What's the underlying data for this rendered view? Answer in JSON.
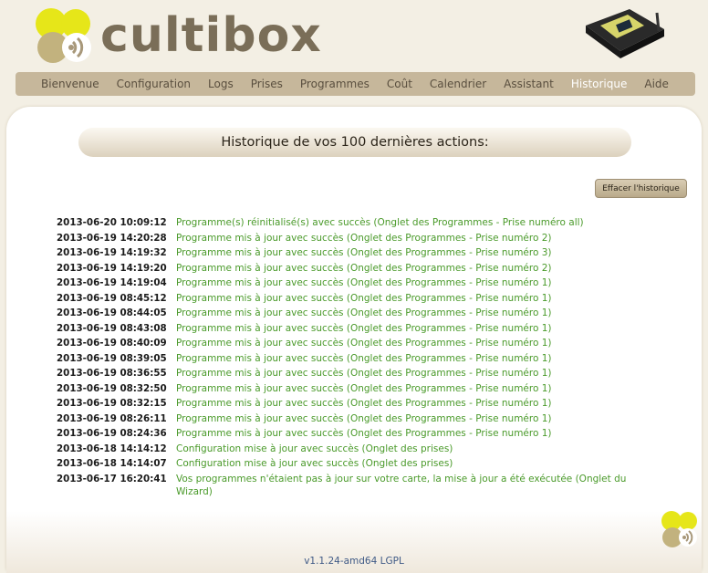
{
  "brand": {
    "logo_text": "cultibox"
  },
  "nav": {
    "items": [
      {
        "label": "Bienvenue"
      },
      {
        "label": "Configuration"
      },
      {
        "label": "Logs"
      },
      {
        "label": "Prises"
      },
      {
        "label": "Programmes"
      },
      {
        "label": "Coût"
      },
      {
        "label": "Calendrier"
      },
      {
        "label": "Assistant"
      },
      {
        "label": "Historique",
        "active": true
      },
      {
        "label": "Aide"
      }
    ]
  },
  "main": {
    "title": "Historique de vos 100 dernières actions:",
    "clear_button": "Effacer l'historique",
    "log": [
      {
        "date": "2013-06-20 10:09:12",
        "message": "Programme(s) réinitialisé(s) avec succès (Onglet des Programmes - Prise numéro all)"
      },
      {
        "date": "2013-06-19 14:20:28",
        "message": "Programme mis à jour avec succès (Onglet des Programmes - Prise numéro 2)"
      },
      {
        "date": "2013-06-19 14:19:32",
        "message": "Programme mis à jour avec succès (Onglet des Programmes - Prise numéro 3)"
      },
      {
        "date": "2013-06-19 14:19:20",
        "message": "Programme mis à jour avec succès (Onglet des Programmes - Prise numéro 2)"
      },
      {
        "date": "2013-06-19 14:19:04",
        "message": "Programme mis à jour avec succès (Onglet des Programmes - Prise numéro 1)"
      },
      {
        "date": "2013-06-19 08:45:12",
        "message": "Programme mis à jour avec succès (Onglet des Programmes - Prise numéro 1)"
      },
      {
        "date": "2013-06-19 08:44:05",
        "message": "Programme mis à jour avec succès (Onglet des Programmes - Prise numéro 1)"
      },
      {
        "date": "2013-06-19 08:43:08",
        "message": "Programme mis à jour avec succès (Onglet des Programmes - Prise numéro 1)"
      },
      {
        "date": "2013-06-19 08:40:09",
        "message": "Programme mis à jour avec succès (Onglet des Programmes - Prise numéro 1)"
      },
      {
        "date": "2013-06-19 08:39:05",
        "message": "Programme mis à jour avec succès (Onglet des Programmes - Prise numéro 1)"
      },
      {
        "date": "2013-06-19 08:36:55",
        "message": "Programme mis à jour avec succès (Onglet des Programmes - Prise numéro 1)"
      },
      {
        "date": "2013-06-19 08:32:50",
        "message": "Programme mis à jour avec succès (Onglet des Programmes - Prise numéro 1)"
      },
      {
        "date": "2013-06-19 08:32:15",
        "message": "Programme mis à jour avec succès (Onglet des Programmes - Prise numéro 1)"
      },
      {
        "date": "2013-06-19 08:26:11",
        "message": "Programme mis à jour avec succès (Onglet des Programmes - Prise numéro 1)"
      },
      {
        "date": "2013-06-19 08:24:36",
        "message": "Programme mis à jour avec succès (Onglet des Programmes - Prise numéro 1)"
      },
      {
        "date": "2013-06-18 14:14:12",
        "message": "Configuration mise à jour avec succès (Onglet des prises)"
      },
      {
        "date": "2013-06-18 14:14:07",
        "message": "Configuration mise à jour avec succès (Onglet des prises)"
      },
      {
        "date": "2013-06-17 16:20:41",
        "message": "Vos programmes n'étaient pas à jour sur votre carte, la mise à jour a été exécutée (Onglet du Wizard)"
      }
    ]
  },
  "footer": {
    "version": "v1.1.24-amd64  LGPL"
  },
  "colors": {
    "nav_bg": "#c6b79b",
    "log_message": "#4a9a2a",
    "logo_yellow": "#e6e619",
    "logo_tan": "#c2b27e"
  },
  "icons": {
    "logo": "cultibox-logo-icon",
    "device": "cultibox-device-icon",
    "footer": "cultibox-small-logo-icon"
  }
}
